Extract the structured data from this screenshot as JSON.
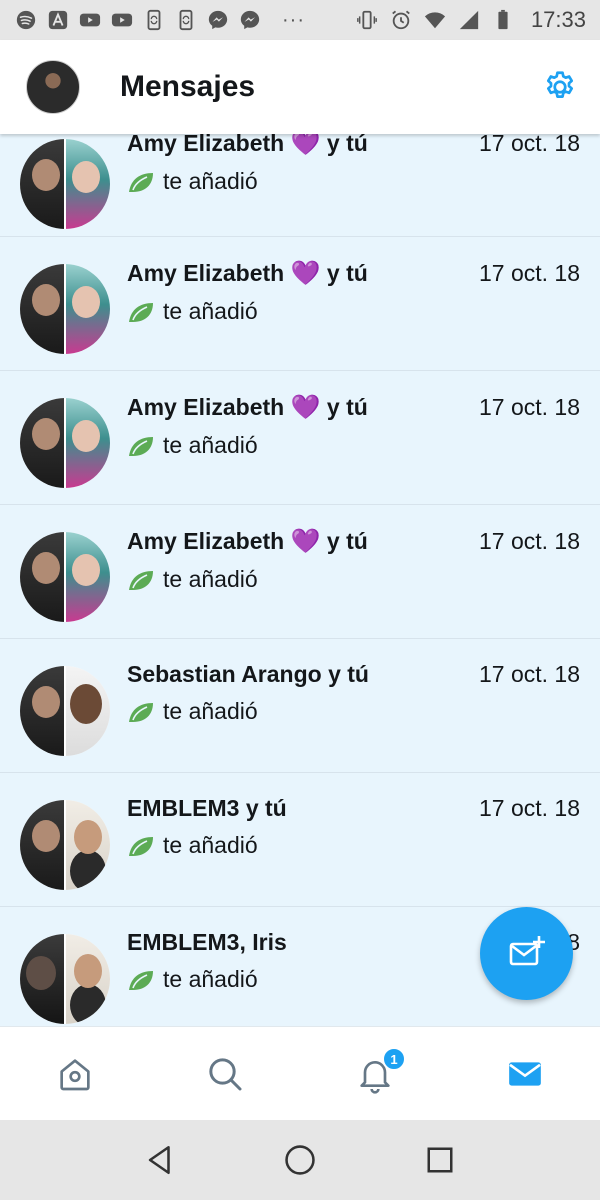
{
  "status_bar": {
    "time": "17:33",
    "left_icons": [
      "spotify-icon",
      "a-app-icon",
      "youtube-icon",
      "youtube-icon",
      "phone-sync-icon",
      "phone-sync-icon",
      "messenger-icon",
      "messenger-icon"
    ],
    "overflow": "···",
    "right_icons": [
      "vibrate-icon",
      "alarm-icon",
      "wifi-icon",
      "signal-icon",
      "battery-icon"
    ]
  },
  "header": {
    "title": "Mensajes",
    "settings_icon": "gear-icon",
    "accent_color": "#1da1f2"
  },
  "conversations": [
    {
      "name": "Amy Elizabeth",
      "heart": "💜",
      "suffix": " y tú",
      "date": "17 oct. 18",
      "preview": "te añadió"
    },
    {
      "name": "Amy Elizabeth",
      "heart": "💜",
      "suffix": " y tú",
      "date": "17 oct. 18",
      "preview": "te añadió"
    },
    {
      "name": "Amy Elizabeth",
      "heart": "💜",
      "suffix": " y tú",
      "date": "17 oct. 18",
      "preview": "te añadió"
    },
    {
      "name": "Amy Elizabeth",
      "heart": "💜",
      "suffix": " y tú",
      "date": "17 oct. 18",
      "preview": "te añadió"
    },
    {
      "name": "Sebastian Arango y tú",
      "heart": "",
      "suffix": "",
      "date": "17 oct. 18",
      "preview": "te añadió"
    },
    {
      "name": "EMBLEM3 y tú",
      "heart": "",
      "suffix": "",
      "date": "17 oct. 18",
      "preview": "te añadió"
    },
    {
      "name": "EMBLEM3, Iris",
      "heart": "",
      "suffix": "",
      "date": "1",
      "date_tail": "8",
      "preview": "te añadió"
    }
  ],
  "fab": {
    "icon": "new-message-icon"
  },
  "bottom_nav": {
    "items": [
      "home-icon",
      "search-icon",
      "notifications-icon",
      "messages-icon"
    ],
    "notification_count": "1",
    "active": "messages-icon"
  },
  "system_nav": {
    "items": [
      "back-icon",
      "home-circle-icon",
      "recents-icon"
    ]
  }
}
